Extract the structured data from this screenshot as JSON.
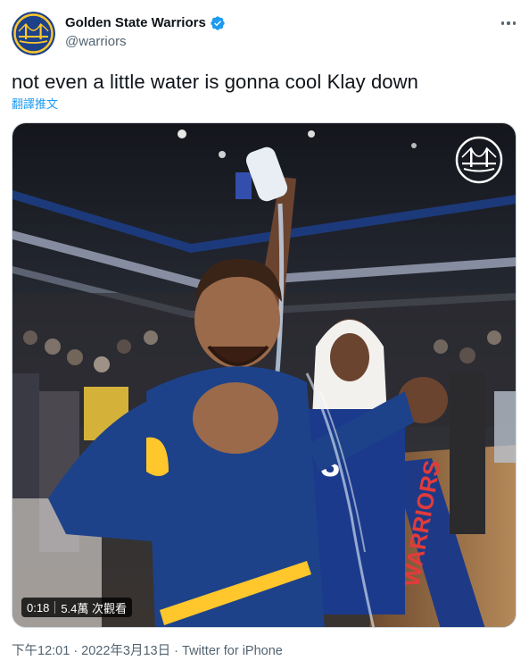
{
  "account": {
    "display_name": "Golden State Warriors",
    "handle": "@warriors",
    "verified": true,
    "avatar_icon": "warriors-bridge-logo-icon",
    "brand_colors": {
      "navy": "#1d428a",
      "gold": "#ffc72c"
    }
  },
  "tweet": {
    "text": "not even a little water is gonna cool Klay down",
    "translate_label": "翻譯推文"
  },
  "media": {
    "type": "video",
    "duration": "0:18",
    "views": "5.4萬 次觀看",
    "watermark_icon": "warriors-bridge-watermark-icon"
  },
  "meta": {
    "time": "下午12:01 · 2022年3月13日",
    "separator": " · ",
    "source": "Twitter for iPhone"
  },
  "colors": {
    "text_primary": "#0f1419",
    "text_secondary": "#536471",
    "link": "#1d9bf0",
    "verified": "#1d9bf0"
  }
}
